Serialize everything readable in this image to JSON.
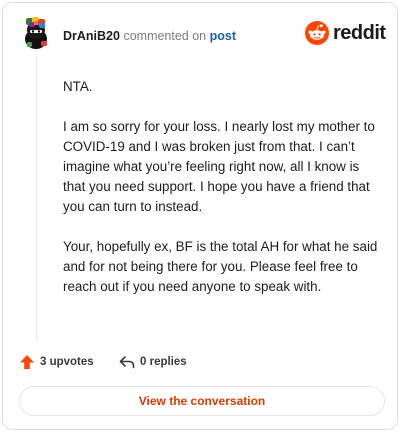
{
  "comment": {
    "username": "DrAniB20",
    "action_text": "commented on",
    "target_link": "post",
    "brand_name": "reddit",
    "paragraphs": [
      "NTA.",
      "I am so sorry for your loss. I nearly lost my mother to COVID-19 and I was broken just from that. I can’t imagine what you’re feeling right now, all I know is that you need support. I hope you have a friend that you can turn to instead.",
      "Your, hopefully ex, BF is the total AH for what he said and for not being there for you. Please feel free to reach out if you need anyone to speak with."
    ]
  },
  "actions": {
    "upvotes_label": "3 upvotes",
    "replies_label": "0 replies"
  },
  "cta": {
    "label": "View the conversation"
  },
  "icons": {
    "upvote": "upvote-arrow-icon",
    "reply": "reply-arrow-icon",
    "brand": "reddit-alien-logo"
  },
  "colors": {
    "brand_orange": "#ff4500",
    "link_blue": "#1d5fa8",
    "cta_text": "#d93a00"
  }
}
